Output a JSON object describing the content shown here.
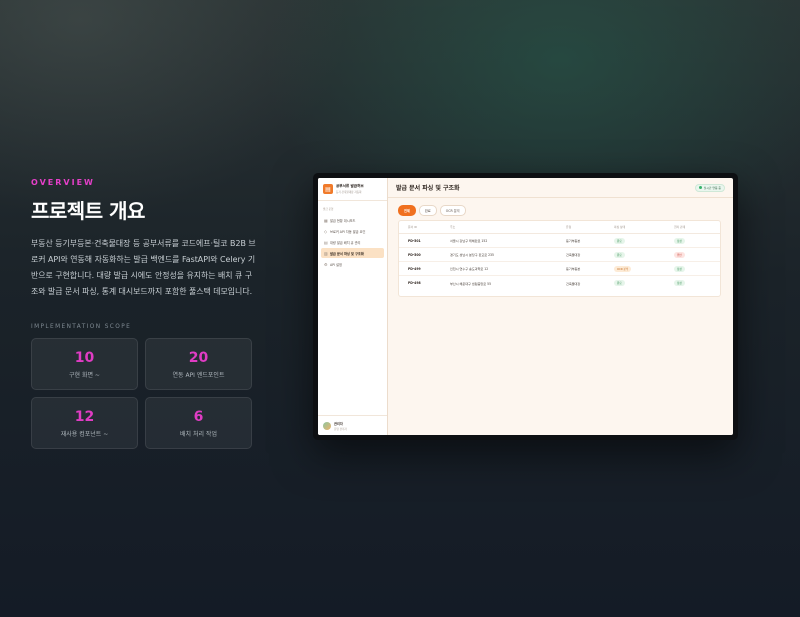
{
  "left": {
    "eyebrow": "OVERVIEW",
    "title": "프로젝트 개요",
    "description": "부동산 등기부등본·건축물대장 등 공부서류를 코드에프·틸코 B2B 브로커 API와 연동해 자동화하는 발급 백엔드를 FastAPI와 Celery 기반으로 구현합니다. 대량 발급 시에도 안정성을 유지하는 배치 큐 구조와 발급 문서 파싱, 통계 대시보드까지 포함한 풀스택 데모입니다.",
    "scope_label": "IMPLEMENTATION SCOPE",
    "stats": [
      {
        "value": "10",
        "label": "구현 화면 ~"
      },
      {
        "value": "20",
        "label": "연동 API 엔드포인트"
      },
      {
        "value": "12",
        "label": "재사용 컴포넌트 ~"
      },
      {
        "value": "6",
        "label": "배치 처리 작업"
      }
    ]
  },
  "app": {
    "brand_title": "공부서류 발급허브",
    "brand_sub": "등기·건축물대장 자동화",
    "nav_label": "발급 운영",
    "nav": [
      {
        "icon": "▦",
        "label": "발급 현황 대시보드"
      },
      {
        "icon": "◇",
        "label": "브로커 API 자동 발급 요인"
      },
      {
        "icon": "▤",
        "label": "대량 발급 배치 큐 관리"
      },
      {
        "icon": "▥",
        "label": "발급 문서 파싱 및 구조화"
      },
      {
        "icon": "⚙",
        "label": "API 설정"
      }
    ],
    "user_name": "관리자",
    "user_role": "운영 관리자",
    "page_title": "발급 문서 파싱 및 구조화",
    "live_badge": "실시간 연동 중",
    "filters": [
      "전체",
      "완료",
      "OCR 분석"
    ],
    "columns": [
      "문서 ID",
      "주소",
      "유형",
      "파싱 상태",
      "권리 관계"
    ],
    "rows": [
      {
        "id": "PD-501",
        "addr": "서울시 강남구 테헤란로 152",
        "type": "등기부등본",
        "status": "완료",
        "status_tone": "green",
        "rights": "정상",
        "rights_tone": "green"
      },
      {
        "id": "PD-500",
        "addr": "경기도 성남시 분당구 판교로 235",
        "type": "건축물대장",
        "status": "완료",
        "status_tone": "green",
        "rights": "위반",
        "rights_tone": "red"
      },
      {
        "id": "PD-499",
        "addr": "인천시 연수구 송도과학로 12",
        "type": "등기부등본",
        "status": "OCR 분석",
        "status_tone": "orange",
        "rights": "정상",
        "rights_tone": "green"
      },
      {
        "id": "PD-498",
        "addr": "부산시 해운대구 센텀중앙로 55",
        "type": "건축물대장",
        "status": "완료",
        "status_tone": "green",
        "rights": "정상",
        "rights_tone": "green"
      }
    ]
  }
}
